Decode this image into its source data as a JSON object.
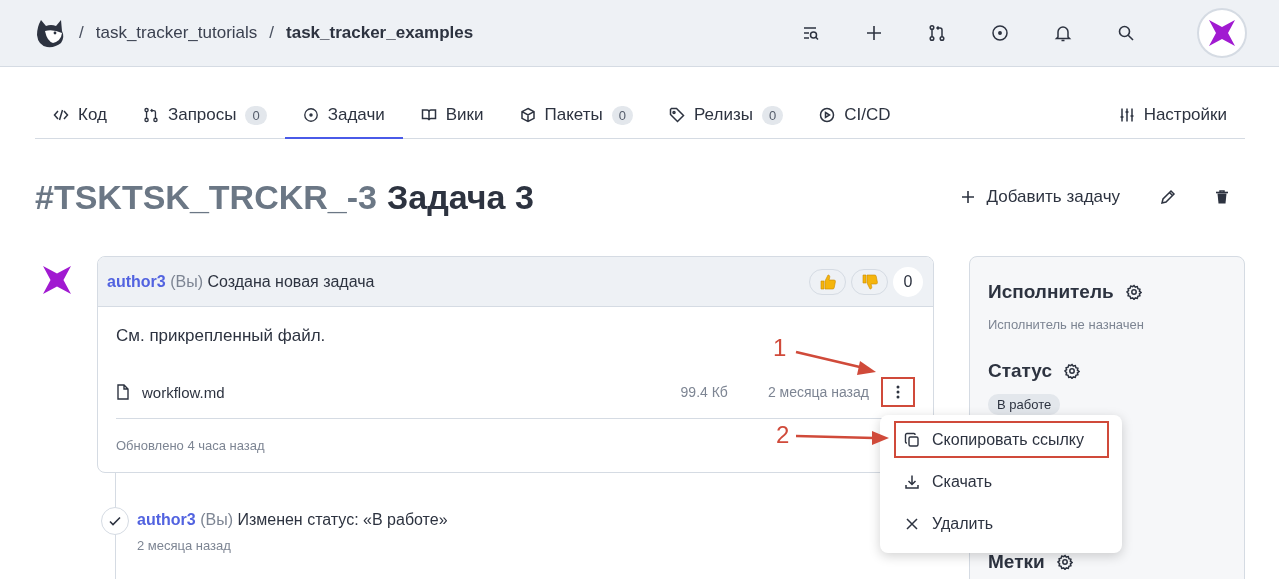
{
  "breadcrumb": [
    {
      "separator": "/",
      "text": "task_tracker_tutorials",
      "current": false
    },
    {
      "separator": "/",
      "text": "task_tracker_examples",
      "current": true
    }
  ],
  "tabs": [
    {
      "kind": "code",
      "label": "Код",
      "selected": false
    },
    {
      "kind": "pulls",
      "label": "Запросы",
      "count": "0",
      "selected": false
    },
    {
      "kind": "issues",
      "label": "Задачи",
      "selected": true
    },
    {
      "kind": "wiki",
      "label": "Вики",
      "selected": false
    },
    {
      "kind": "packages",
      "label": "Пакеты",
      "count": "0",
      "selected": false
    },
    {
      "kind": "releases",
      "label": "Релизы",
      "count": "0",
      "selected": false
    },
    {
      "kind": "cicd",
      "label": "CI/CD",
      "selected": false
    }
  ],
  "settings_tab": {
    "label": "Настройки"
  },
  "issue": {
    "number": "#TSKTSK_TRCKR_-3",
    "title": "Задача 3",
    "add_button": "Добавить задачу"
  },
  "comment": {
    "author": "author3",
    "you": "(Вы)",
    "action": "Создана новая задача",
    "reaction_count": "0",
    "body": "См. прикрепленный файл.",
    "attachment": {
      "name": "workflow.md",
      "size": "99.4 Кб",
      "date": "2 месяца назад",
      "highlighted": true
    },
    "updated": "Обновлено 4 часа назад"
  },
  "events": [
    {
      "author": "author3",
      "you": "(Вы)",
      "action": "Изменен статус: «В работе»",
      "date": "2 месяца назад"
    }
  ],
  "sidebar": [
    {
      "title": "Исполнитель",
      "kind": "text",
      "value": "Исполнитель не назначен"
    },
    {
      "title": "Статус",
      "kind": "tag",
      "value": "В работе"
    },
    {
      "title": "Метки",
      "kind": "title"
    }
  ],
  "menu": [
    {
      "kind": "copy",
      "label": "Скопировать ссылку",
      "highlighted": true
    },
    {
      "kind": "download",
      "label": "Скачать",
      "highlighted": false
    },
    {
      "kind": "delete",
      "label": "Удалить",
      "highlighted": false
    }
  ],
  "annotations": [
    {
      "label": "1"
    },
    {
      "label": "2"
    }
  ]
}
